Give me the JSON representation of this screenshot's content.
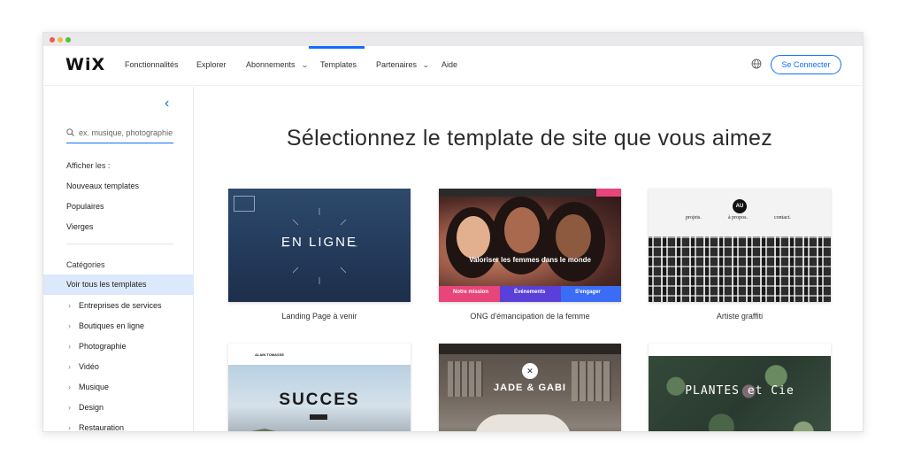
{
  "nav": {
    "logo": "WiX",
    "items": [
      {
        "label": "Fonctionnalités",
        "has_chevron": false
      },
      {
        "label": "Explorer",
        "has_chevron": false
      },
      {
        "label": "Abonnements",
        "has_chevron": true
      },
      {
        "label": "Templates",
        "has_chevron": false,
        "active": true
      },
      {
        "label": "Partenaires",
        "has_chevron": true
      },
      {
        "label": "Aide",
        "has_chevron": false
      }
    ],
    "login_label": "Se Connecter",
    "globe_icon": "globe-icon",
    "accent_color": "#116dff"
  },
  "sidebar": {
    "search_placeholder": "ex. musique, photographie",
    "show_label": "Afficher les :",
    "filters": [
      "Nouveaux templates",
      "Populaires",
      "Vierges"
    ],
    "categories_label": "Catégories",
    "active_category": "Voir tous les templates",
    "categories": [
      "Entreprises de services",
      "Boutiques en ligne",
      "Photographie",
      "Vidéo",
      "Musique",
      "Design",
      "Restauration"
    ]
  },
  "main": {
    "heading": "Sélectionnez le template de site que vous aimez",
    "templates": [
      {
        "caption": "Landing Page à venir",
        "thumb_text": "EN LIGNE"
      },
      {
        "caption": "ONG d'émancipation de la femme",
        "thumb_headline": "Valoriser les femmes dans le monde",
        "bands": [
          "Notre mission",
          "Événements",
          "S'engager"
        ]
      },
      {
        "caption": "Artiste graffiti",
        "thumb_menu": [
          "projets.",
          "à propos.",
          "contact."
        ],
        "badge": "AU"
      },
      {
        "caption": "",
        "thumb_text": "SUCCES",
        "thumb_name": "ALAIN TOMASSE"
      },
      {
        "caption": "",
        "thumb_text": "JADE & GABI"
      },
      {
        "caption": "",
        "thumb_text": "PLANTES et Cie"
      }
    ]
  }
}
